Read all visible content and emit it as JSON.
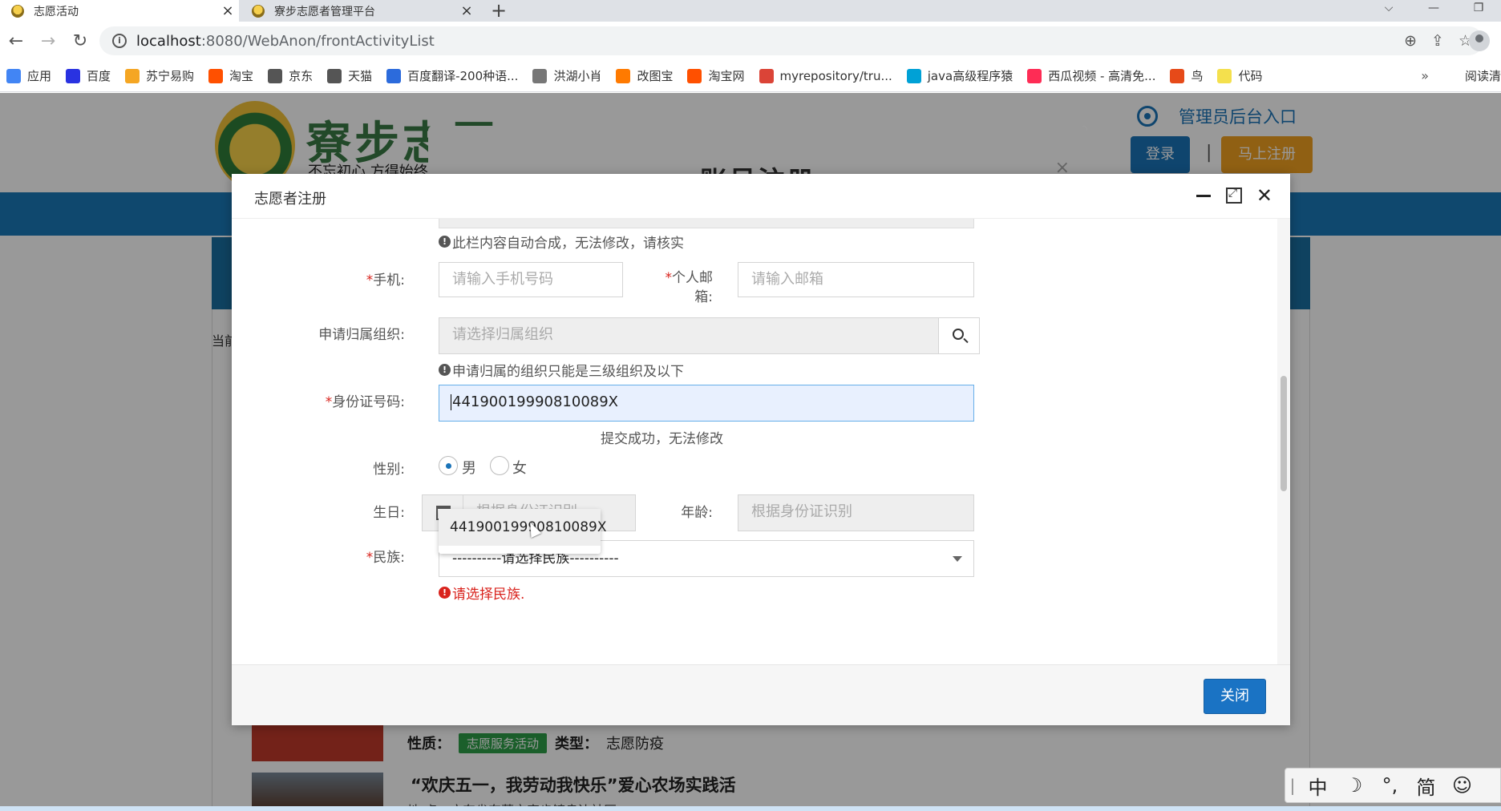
{
  "browser": {
    "tabs": [
      {
        "title": "志愿活动",
        "active": true
      },
      {
        "title": "寮步志愿者管理平台",
        "active": false
      }
    ],
    "new_tab": "+",
    "url_host": "localhost",
    "url_rest": ":8080/WebAnon/frontActivityList",
    "bookmarks": [
      {
        "label": "应用",
        "color": "#4285f4"
      },
      {
        "label": "百度",
        "color": "#2932e1"
      },
      {
        "label": "苏宁易购",
        "color": "#f5a623"
      },
      {
        "label": "淘宝",
        "color": "#ff5000"
      },
      {
        "label": "京东",
        "color": "#555555"
      },
      {
        "label": "天猫",
        "color": "#555555"
      },
      {
        "label": "百度翻译-200种语...",
        "color": "#2c6bdc"
      },
      {
        "label": "洪湖小肖",
        "color": "#777777"
      },
      {
        "label": "改图宝",
        "color": "#ff7a00"
      },
      {
        "label": "淘宝网",
        "color": "#ff5000"
      },
      {
        "label": "myrepository/tru...",
        "color": "#db4437"
      },
      {
        "label": "java高级程序猿",
        "color": "#00a1d6"
      },
      {
        "label": "西瓜视频 - 高清免...",
        "color": "#fe2c55"
      },
      {
        "label": "鸟",
        "color": "#e64a19"
      },
      {
        "label": "代码",
        "color": "#f4e04d"
      }
    ],
    "bookmarks_more": "»",
    "reading_list": "阅读清"
  },
  "site": {
    "logo_text": "寮步志愿",
    "slogan": "不忘初心  方得始终",
    "admin_entry": "管理员后台入口",
    "login": "登录",
    "separator": "|",
    "register": "马上注册",
    "crumb": "当前",
    "activity1": {
      "nature_label": "性质：",
      "nature_tag": "志愿服务活动",
      "type_label": "类型：",
      "type_value": "志愿防疫"
    },
    "activity2": {
      "title": "“欢庆五一，我劳动我快乐”爱心农场实践活",
      "sub": "地    点：广东省东莞市寮步镇良边社区"
    }
  },
  "back_dialog": {
    "title": "账号注册",
    "close": "×"
  },
  "modal": {
    "title": "志愿者注册",
    "help_autogen": "此栏内容自动合成，无法修改，请核实",
    "phone_label": "手机:",
    "phone_placeholder": "请输入手机号码",
    "email_label_1": "个人邮",
    "email_label_2": "箱:",
    "email_placeholder": "请输入邮箱",
    "org_label": "申请归属组织:",
    "org_placeholder": "请选择归属组织",
    "org_help": "申请归属的组织只能是三级组织及以下",
    "id_label": "身份证号码:",
    "id_value": "44190019990810089X",
    "id_help_tail": "提交成功，无法修改",
    "autocomplete_value": "44190019990810089X",
    "gender_label": "性别:",
    "gender_male": "男",
    "gender_female": "女",
    "gender_selected": "男",
    "birthday_label": "生日:",
    "birthday_placeholder": "根据身份证识别",
    "age_label": "年龄:",
    "age_placeholder": "根据身份证识别",
    "ethnic_label": "民族:",
    "ethnic_selected": "----------请选择民族----------",
    "ethnic_error": "请选择民族.",
    "required_mark": "*",
    "close_button": "关闭"
  },
  "ime": {
    "items": [
      "中",
      "☽",
      "°,",
      "简",
      "☺"
    ]
  },
  "colors": {
    "primary": "#1a73c4",
    "error": "#d9231d",
    "brand_green": "#3a7a45",
    "nav_blue": "#1a78b8",
    "register_orange": "#f0a020"
  }
}
